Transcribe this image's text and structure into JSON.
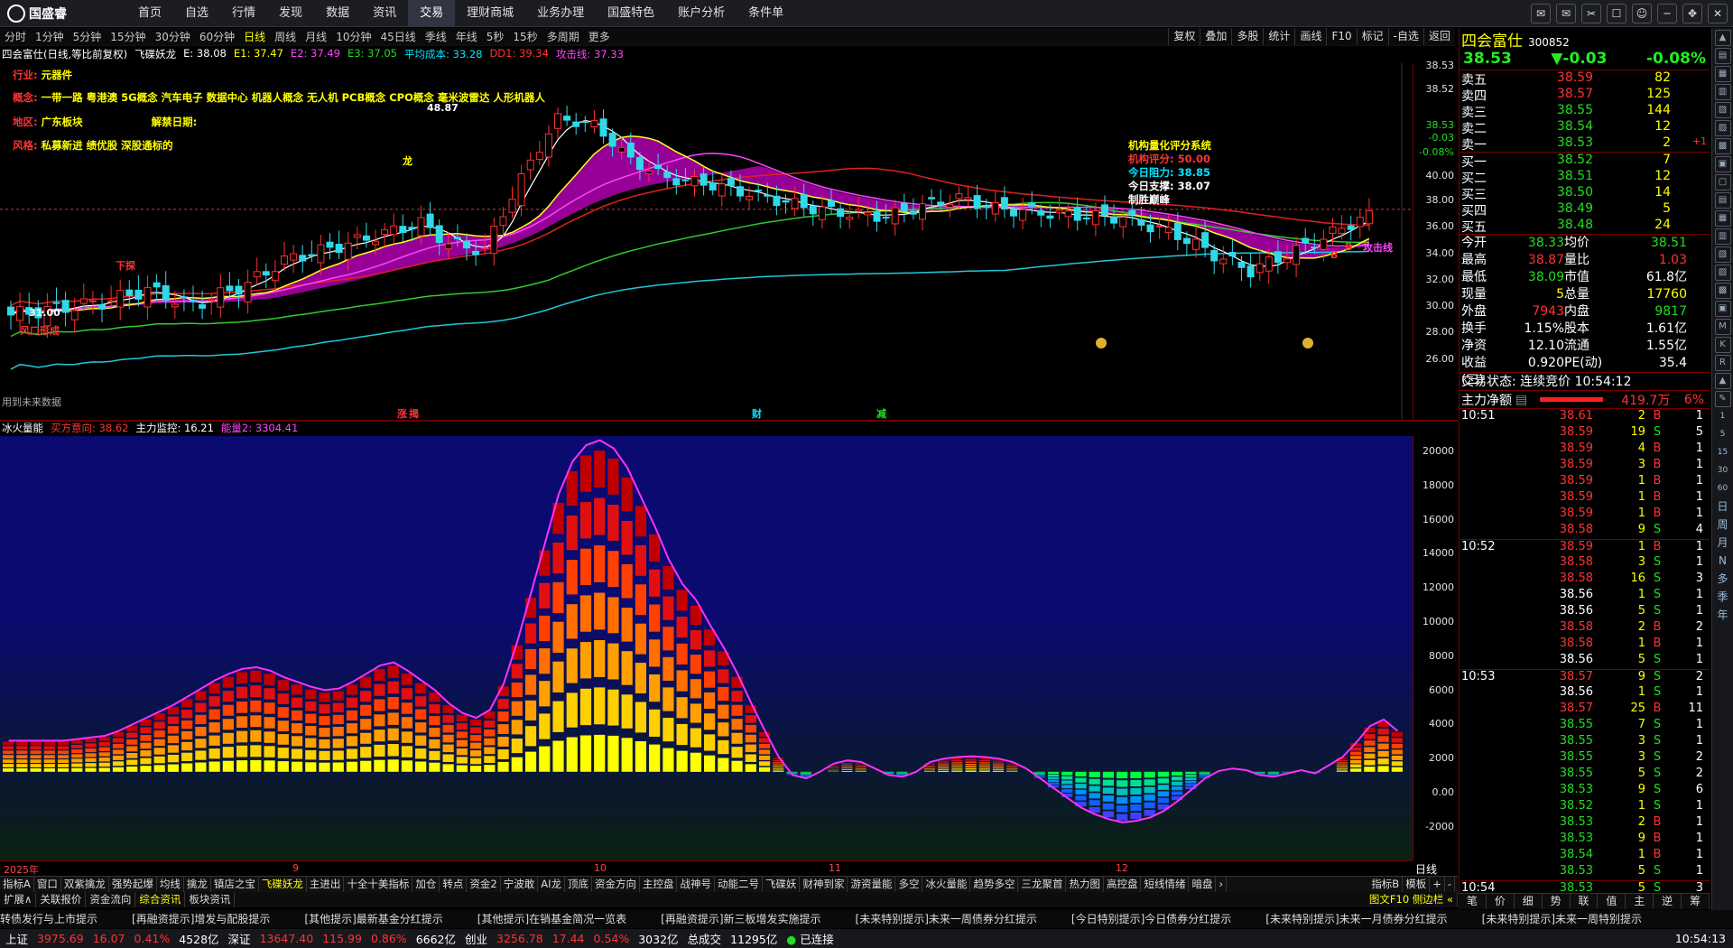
{
  "app": {
    "logo": "国盛睿"
  },
  "menu": [
    "首页",
    "自选",
    "行情",
    "发现",
    "数据",
    "资讯",
    "交易",
    "理财商城",
    "业务办理",
    "国盛特色",
    "账户分析",
    "条件单"
  ],
  "menu_active": 6,
  "periods": [
    "分时",
    "1分钟",
    "5分钟",
    "15分钟",
    "30分钟",
    "60分钟",
    "日线",
    "周线",
    "月线",
    "10分钟",
    "45日线",
    "季线",
    "年线",
    "5秒",
    "15秒",
    "多周期",
    "更多"
  ],
  "period_active": 6,
  "tools": [
    "复权",
    "叠加",
    "多股",
    "统计",
    "画线",
    "F10",
    "标记",
    "-自选",
    "返回"
  ],
  "main_info": {
    "title": "四会富仕(日线,等比前复权)",
    "ind": "飞碟妖龙",
    "e": "E: 38.08",
    "e1": "E1: 37.47",
    "e2": "E2: 37.49",
    "e3": "E3: 37.05",
    "avg": "平均成本: 33.28",
    "dd1": "DD1: 39.34",
    "atk": "攻击线: 37.33"
  },
  "overlay": {
    "industry_k": "行业:",
    "industry": "元器件",
    "concept_k": "概念:",
    "concept": "一带一路 粤港澳 5G概念 汽车电子 数据中心 机器人概念 无人机 PCB概念 CPO概念 毫米波雷达 人形机器人",
    "region_k": "地区:",
    "region": "广东板块",
    "unlock": "解禁日期:",
    "style_k": "风格:",
    "style": "私募新进 绩优股 深股通标的",
    "inst_title": "机构量化评分系统",
    "inst_score": "机构评分: 50.00",
    "resist": "今日阻力: 38.85",
    "support": "今日支撑: 38.07",
    "win": "制胜巅峰",
    "hi_label": "48.87",
    "lo_label": "31.00",
    "m_xiaguo": "下探",
    "m_long": "龙",
    "m_fengkou": "风口形成",
    "m_atk": "攻击线",
    "m_future": "用到未来数据",
    "ev1": "涨",
    "ev2": "揭",
    "ev3": "财",
    "ev4": "减",
    "b1": "B",
    "b2": "B"
  },
  "yaxis1": [
    "38.53",
    "38.52",
    "38.53",
    "-0.03",
    "-0.08%",
    "40.00",
    "38.00",
    "36.00",
    "34.00",
    "32.00",
    "30.00",
    "28.00",
    "26.00"
  ],
  "sub_info": {
    "name": "冰火量能",
    "buy": "买方意向: 38.62",
    "main": "主力监控: 16.21",
    "vol": "能量2: 3304.41"
  },
  "yaxis2": [
    "20000",
    "18000",
    "16000",
    "14000",
    "12000",
    "10000",
    "8000",
    "6000",
    "4000",
    "2000",
    "0.00",
    "-2000"
  ],
  "dates": [
    "2025年",
    "9",
    "10",
    "11",
    "12"
  ],
  "period_label": "日线",
  "indicators": [
    "指标A",
    "窗口",
    "双紫擒龙",
    "强势起爆",
    "均线",
    "擒龙",
    "镇店之宝",
    "飞碟妖龙",
    "主进出",
    "十全十美指标",
    "加仓",
    "转点",
    "资金2",
    "宁波敢",
    "AI龙",
    "顶底",
    "资金方向",
    "主控盘",
    "战神号",
    "动能二号",
    "飞碟妖",
    "财神到家",
    "游资量能",
    "多空",
    "冰火量能",
    "趋势多空",
    "三龙聚首",
    "热力图",
    "高控盘",
    "短线情绪",
    "暗盘"
  ],
  "ind_active": 7,
  "ind_right": [
    "指标B",
    "模板",
    "+",
    "-"
  ],
  "bottom_tabs": [
    "扩展∧",
    "关联报价",
    "资金流向",
    "综合资讯",
    "板块资讯"
  ],
  "bottom_active": 3,
  "bottom_right": "图文F10 侧边栏 «",
  "news": [
    "转债发行与上市提示",
    "[再融资提示]增发与配股提示",
    "[其他提示]最新基金分红提示",
    "[其他提示]在销基金简况一览表",
    "[再融资提示]新三板增发实施提示",
    "[未来特别提示]未来一周债券分红提示",
    "[今日特别提示]今日债券分红提示",
    "[未来特别提示]未来一月债券分红提示",
    "[未来特别提示]未来一周特别提示"
  ],
  "status": {
    "sh": "上证",
    "sh_v": "3975.69",
    "sh_c": "16.07",
    "sh_p": "0.41%",
    "sh_a": "4528亿",
    "sz": "深证",
    "sz_v": "13647.40",
    "sz_c": "115.99",
    "sz_p": "0.86%",
    "sz_a": "6662亿",
    "cy": "创业",
    "cy_v": "3256.78",
    "cy_c": "17.44",
    "cy_p": "0.54%",
    "cy_a": "3032亿",
    "tot": "总成交",
    "tot_v": "11295亿",
    "conn": "已连接",
    "time": "10:54:13"
  },
  "stock": {
    "name": "四会富仕",
    "code": "300852",
    "price": "38.53",
    "chg": "▼-0.03",
    "pct": "-0.08%"
  },
  "asks": [
    {
      "l": "卖五",
      "p": "38.59",
      "v": "82",
      "c": ""
    },
    {
      "l": "卖四",
      "p": "38.57",
      "v": "125",
      "c": ""
    },
    {
      "l": "卖三",
      "p": "38.55",
      "v": "144",
      "c": ""
    },
    {
      "l": "卖二",
      "p": "38.54",
      "v": "12",
      "c": ""
    },
    {
      "l": "卖一",
      "p": "38.53",
      "v": "2",
      "c": "+1"
    }
  ],
  "bids": [
    {
      "l": "买一",
      "p": "38.52",
      "v": "7",
      "c": ""
    },
    {
      "l": "买二",
      "p": "38.51",
      "v": "12",
      "c": ""
    },
    {
      "l": "买三",
      "p": "38.50",
      "v": "14",
      "c": ""
    },
    {
      "l": "买四",
      "p": "38.49",
      "v": "5",
      "c": ""
    },
    {
      "l": "买五",
      "p": "38.48",
      "v": "24",
      "c": ""
    }
  ],
  "stats": [
    [
      "今开",
      "38.33",
      "均价",
      "38.51"
    ],
    [
      "最高",
      "38.87",
      "量比",
      "1.03"
    ],
    [
      "最低",
      "38.09",
      "市值",
      "61.8亿"
    ],
    [
      "现量",
      "5",
      "总量",
      "17760"
    ],
    [
      "外盘",
      "7943",
      "内盘",
      "9817"
    ],
    [
      "换手",
      "1.15%",
      "股本",
      "1.61亿"
    ],
    [
      "净资",
      "12.10",
      "流通",
      "1.55亿"
    ],
    [
      "收益(三)",
      "0.920",
      "PE(动)",
      "35.4"
    ]
  ],
  "trade_status": "交易状态: 连续竞价 10:54:12",
  "flow": {
    "label": "主力净额",
    "value": "419.7万",
    "pct": "6%"
  },
  "ticks": [
    {
      "t": "10:51",
      "p": "38.61",
      "v": "2",
      "d": "B",
      "n": "1"
    },
    {
      "t": "",
      "p": "38.59",
      "v": "19",
      "d": "S",
      "n": "5"
    },
    {
      "t": "",
      "p": "38.59",
      "v": "4",
      "d": "B",
      "n": "1"
    },
    {
      "t": "",
      "p": "38.59",
      "v": "3",
      "d": "B",
      "n": "1"
    },
    {
      "t": "",
      "p": "38.59",
      "v": "1",
      "d": "B",
      "n": "1"
    },
    {
      "t": "",
      "p": "38.59",
      "v": "1",
      "d": "B",
      "n": "1"
    },
    {
      "t": "",
      "p": "38.59",
      "v": "1",
      "d": "B",
      "n": "1"
    },
    {
      "t": "",
      "p": "38.58",
      "v": "9",
      "d": "S",
      "n": "4"
    },
    {
      "t": "10:52",
      "p": "38.59",
      "v": "1",
      "d": "B",
      "n": "1"
    },
    {
      "t": "",
      "p": "38.58",
      "v": "3",
      "d": "S",
      "n": "1"
    },
    {
      "t": "",
      "p": "38.58",
      "v": "16",
      "d": "S",
      "n": "3"
    },
    {
      "t": "",
      "p": "38.56",
      "v": "1",
      "d": "S",
      "n": "1"
    },
    {
      "t": "",
      "p": "38.56",
      "v": "5",
      "d": "S",
      "n": "1"
    },
    {
      "t": "",
      "p": "38.58",
      "v": "2",
      "d": "B",
      "n": "2"
    },
    {
      "t": "",
      "p": "38.58",
      "v": "1",
      "d": "B",
      "n": "1"
    },
    {
      "t": "",
      "p": "38.56",
      "v": "5",
      "d": "S",
      "n": "1"
    },
    {
      "t": "10:53",
      "p": "38.57",
      "v": "9",
      "d": "S",
      "n": "2"
    },
    {
      "t": "",
      "p": "38.56",
      "v": "1",
      "d": "S",
      "n": "1"
    },
    {
      "t": "",
      "p": "38.57",
      "v": "25",
      "d": "B",
      "n": "11"
    },
    {
      "t": "",
      "p": "38.55",
      "v": "7",
      "d": "S",
      "n": "1"
    },
    {
      "t": "",
      "p": "38.55",
      "v": "3",
      "d": "S",
      "n": "1"
    },
    {
      "t": "",
      "p": "38.55",
      "v": "3",
      "d": "S",
      "n": "2"
    },
    {
      "t": "",
      "p": "38.55",
      "v": "5",
      "d": "S",
      "n": "2"
    },
    {
      "t": "",
      "p": "38.53",
      "v": "9",
      "d": "S",
      "n": "6"
    },
    {
      "t": "",
      "p": "38.52",
      "v": "1",
      "d": "S",
      "n": "1"
    },
    {
      "t": "",
      "p": "38.53",
      "v": "2",
      "d": "B",
      "n": "1"
    },
    {
      "t": "",
      "p": "38.53",
      "v": "9",
      "d": "B",
      "n": "1"
    },
    {
      "t": "",
      "p": "38.54",
      "v": "1",
      "d": "B",
      "n": "1"
    },
    {
      "t": "",
      "p": "38.53",
      "v": "5",
      "d": "S",
      "n": "1"
    },
    {
      "t": "10:54",
      "p": "38.53",
      "v": "5",
      "d": "S",
      "n": "3"
    }
  ],
  "rp_tabs": [
    "笔",
    "价",
    "细",
    "势",
    "联",
    "值",
    "主",
    "逆",
    "筹"
  ],
  "side": [
    "日",
    "周",
    "月",
    "N",
    "多",
    "季",
    "年"
  ],
  "chart_data": [
    {
      "type": "line",
      "title": "四会富仕(日线,等比前复权)",
      "y_range": [
        26,
        48.87
      ],
      "series": [
        {
          "name": "E",
          "values": [
            38.08
          ]
        },
        {
          "name": "E1",
          "values": [
            37.47
          ]
        },
        {
          "name": "E2",
          "values": [
            37.49
          ]
        },
        {
          "name": "E3",
          "values": [
            37.05
          ]
        },
        {
          "name": "平均成本",
          "values": [
            33.28
          ]
        },
        {
          "name": "DD1",
          "values": [
            39.34
          ]
        },
        {
          "name": "攻击线",
          "values": [
            37.33
          ]
        }
      ]
    },
    {
      "type": "bar",
      "title": "冰火量能",
      "y_range": [
        -2000,
        20000
      ],
      "values": [
        1900,
        1900,
        1900,
        1900,
        1900,
        2000,
        2100,
        2200,
        2500,
        2900,
        3300,
        3700,
        4100,
        4600,
        5100,
        5600,
        6000,
        6300,
        6400,
        6200,
        5800,
        5500,
        5200,
        5000,
        5100,
        5500,
        6000,
        6500,
        6700,
        6200,
        5600,
        5000,
        4200,
        3600,
        3300,
        3800,
        5400,
        8000,
        11000,
        14000,
        17000,
        19000,
        20000,
        20300,
        19800,
        18600,
        16800,
        15000,
        13000,
        11500,
        10500,
        9000,
        7600,
        6000,
        4200,
        2500,
        900,
        -200,
        -400,
        0,
        500,
        700,
        600,
        200,
        -200,
        -300,
        0,
        600,
        800,
        900,
        950,
        900,
        800,
        600,
        200,
        -400,
        -1000,
        -1600,
        -2200,
        -2600,
        -2900,
        -3100,
        -3000,
        -2800,
        -2400,
        -1800,
        -1100,
        -400,
        50,
        200,
        100,
        -200,
        -300,
        -100,
        100,
        -100,
        400,
        900,
        1800,
        2800,
        3200,
        2500
      ]
    }
  ]
}
